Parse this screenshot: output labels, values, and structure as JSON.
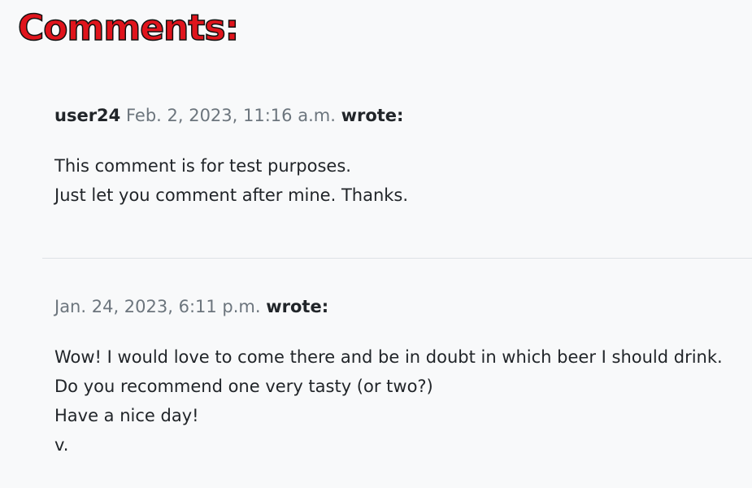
{
  "section": {
    "title": "Comments:"
  },
  "comments": [
    {
      "author": "user24",
      "date": "Feb. 2, 2023, 11:16 a.m.",
      "wrote": "wrote:",
      "lines": [
        "This comment is for test purposes.",
        "Just let you comment after mine. Thanks."
      ]
    },
    {
      "author": "",
      "date": "Jan. 24, 2023, 6:11 p.m.",
      "wrote": "wrote:",
      "lines": [
        "Wow! I would love to come there and be in doubt in which beer I should drink.",
        "Do you recommend one very tasty (or two?)",
        "Have a nice day!",
        "v."
      ]
    }
  ]
}
